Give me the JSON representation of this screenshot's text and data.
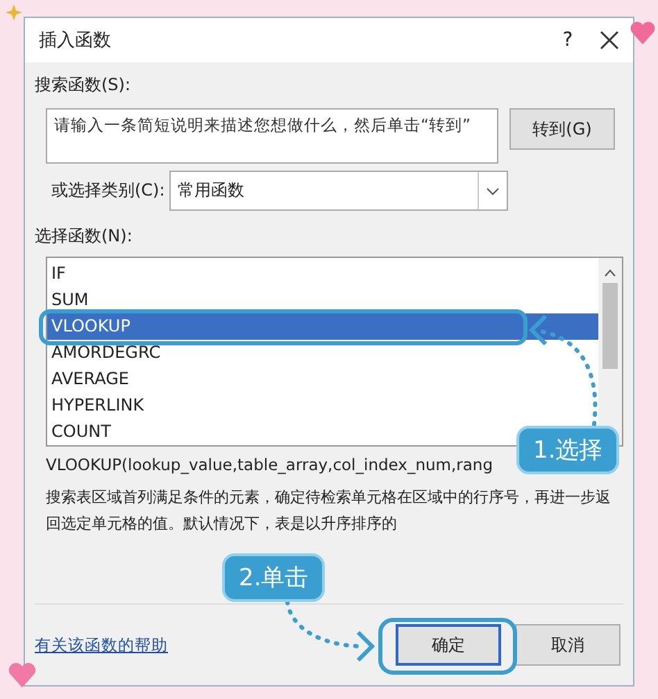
{
  "window": {
    "title": "插入函数",
    "help_button": "?"
  },
  "search": {
    "label": "搜索函数(S):",
    "placeholder": "请输入一条简短说明来描述您想做什么，然后单击“转到”",
    "go_button": "转到(G)"
  },
  "category": {
    "label": "或选择类别(C):",
    "value": "常用函数"
  },
  "functions": {
    "label": "选择函数(N):",
    "items": [
      {
        "name": "IF",
        "selected": false
      },
      {
        "name": "SUM",
        "selected": false
      },
      {
        "name": "VLOOKUP",
        "selected": true
      },
      {
        "name": "AMORDEGRC",
        "selected": false
      },
      {
        "name": "AVERAGE",
        "selected": false
      },
      {
        "name": "HYPERLINK",
        "selected": false
      },
      {
        "name": "COUNT",
        "selected": false
      }
    ]
  },
  "signature": "VLOOKUP(lookup_value,table_array,col_index_num,rang",
  "description": "搜索表区域首列满足条件的元素，确定待检索单元格在区域中的行序号，再进一步返回选定单元格的值。默认情况下，表是以升序排序的",
  "help_link": "有关该函数的帮助",
  "buttons": [
    {
      "label": "确定",
      "kind": "ok"
    },
    {
      "label": "取消",
      "kind": "cancel"
    }
  ],
  "annotations": [
    {
      "label": "1.选择"
    },
    {
      "label": "2.单击"
    }
  ]
}
